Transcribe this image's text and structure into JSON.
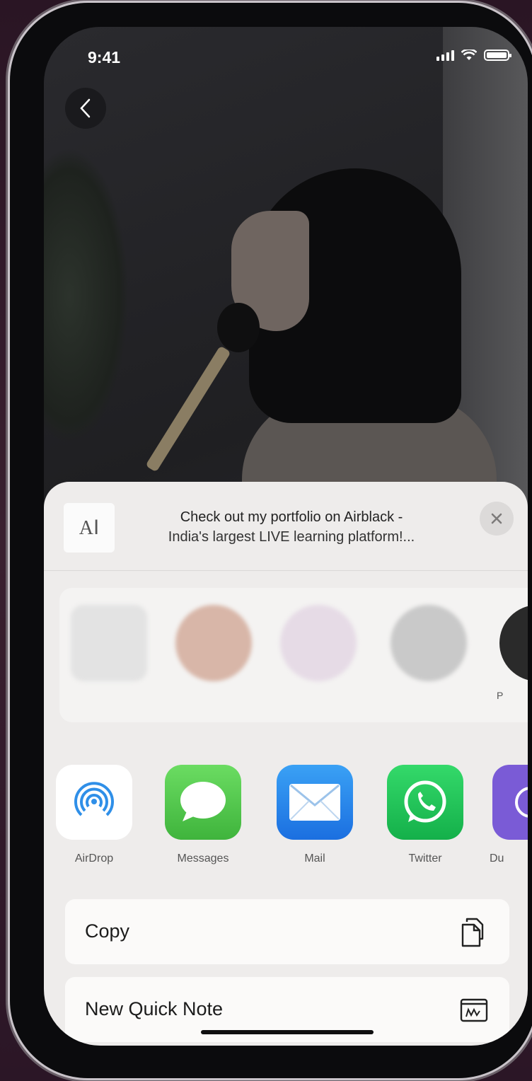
{
  "status_bar": {
    "time": "9:41"
  },
  "share_sheet": {
    "thumbnail_text": "AⅠ",
    "title_line1": "Check out my portfolio on Airblack -",
    "title_line2": "India's largest LIVE learning platform!..."
  },
  "contacts": [
    {
      "name": ""
    },
    {
      "name": ""
    },
    {
      "name": ""
    },
    {
      "name": ""
    },
    {
      "name": "P"
    }
  ],
  "apps": [
    {
      "label": "AirDrop",
      "icon": "airdrop-icon",
      "color": "#ffffff"
    },
    {
      "label": "Messages",
      "icon": "messages-icon",
      "color": "#4fc94b"
    },
    {
      "label": "Mail",
      "icon": "mail-icon",
      "color": "#2d8ef0"
    },
    {
      "label": "Twitter",
      "icon": "whatsapp-icon",
      "color": "#22c05a"
    },
    {
      "label": "Du",
      "icon": "app-icon",
      "color": "#7a5bd6"
    }
  ],
  "actions": [
    {
      "label": "Copy",
      "icon": "copy-icon"
    },
    {
      "label": "New Quick Note",
      "icon": "quick-note-icon"
    }
  ]
}
